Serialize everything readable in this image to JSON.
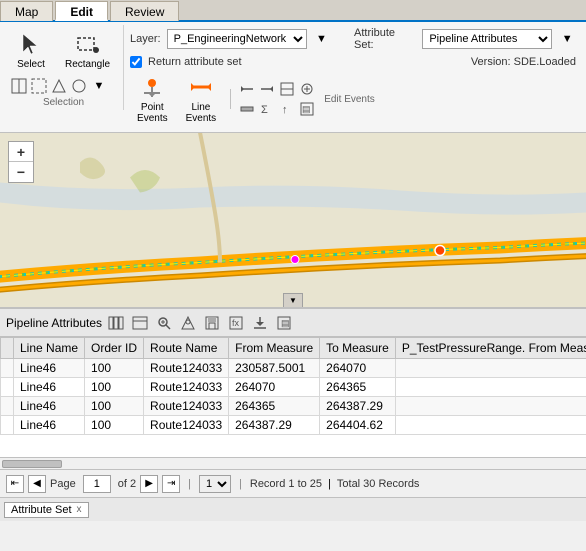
{
  "tabs": {
    "items": [
      {
        "label": "Map",
        "active": false
      },
      {
        "label": "Edit",
        "active": true
      },
      {
        "label": "Review",
        "active": false
      }
    ]
  },
  "ribbon": {
    "layer_label": "Layer:",
    "layer_value": "P_EngineeringNetwork",
    "return_attr_label": "Return attribute set",
    "return_attr_checked": true,
    "attr_set_label": "Attribute Set:",
    "attr_set_value": "Pipeline Attributes",
    "version_label": "Version: SDE.Loaded",
    "selection_label": "Selection",
    "edit_events_label": "Edit Events",
    "select_label": "Select",
    "rectangle_label": "Rectangle",
    "point_events_label": "Point\nEvents",
    "line_events_label": "Line\nEvents"
  },
  "map": {
    "zoom_in": "+",
    "zoom_out": "−"
  },
  "attribute_table": {
    "title": "Pipeline Attributes",
    "columns": [
      {
        "label": "Line Name"
      },
      {
        "label": "Order ID"
      },
      {
        "label": "Route Name"
      },
      {
        "label": "From Measure"
      },
      {
        "label": "To Measure"
      },
      {
        "label": "P_TestPressureRange. From Measure"
      }
    ],
    "rows": [
      {
        "line_name": "Line46",
        "order_id": "100",
        "route_name": "Route124033",
        "from_measure": "230587.5001",
        "to_measure": "264070",
        "extra": "<null>"
      },
      {
        "line_name": "Line46",
        "order_id": "100",
        "route_name": "Route124033",
        "from_measure": "264070",
        "to_measure": "264365",
        "extra": "<null>"
      },
      {
        "line_name": "Line46",
        "order_id": "100",
        "route_name": "Route124033",
        "from_measure": "264365",
        "to_measure": "264387.29",
        "extra": "<null>"
      },
      {
        "line_name": "Line46",
        "order_id": "100",
        "route_name": "Route124033",
        "from_measure": "264387.29",
        "to_measure": "264404.62",
        "extra": "<null>"
      }
    ]
  },
  "pagination": {
    "page_text": "Page 1 of 2",
    "page_num": "1",
    "record_text": "Record 1 to 25",
    "total_text": "Total 30 Records"
  },
  "bottom_tab": {
    "label": "Attribute Set",
    "close": "x"
  }
}
